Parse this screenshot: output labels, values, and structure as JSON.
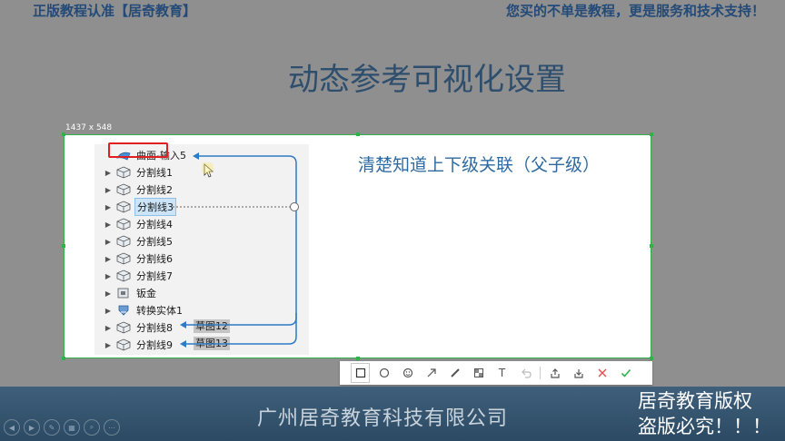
{
  "banner": {
    "left": "正版教程认准【居奇教育】",
    "right": "您买的不单是教程，更是服务和技术支持！"
  },
  "slide": {
    "title": "动态参考可视化设置",
    "annotation": "清楚知道上下级关联（父子级）"
  },
  "capture": {
    "dimensions": "1437 x 548"
  },
  "tree": {
    "items": [
      {
        "label": "曲面-输入5",
        "icon": "surface-icon",
        "selected": false
      },
      {
        "label": "分割线1",
        "icon": "part-icon",
        "selected": false
      },
      {
        "label": "分割线2",
        "icon": "part-icon",
        "selected": false
      },
      {
        "label": "分割线3",
        "icon": "part-icon",
        "selected": true
      },
      {
        "label": "分割线4",
        "icon": "part-icon",
        "selected": false
      },
      {
        "label": "分割线5",
        "icon": "part-icon",
        "selected": false
      },
      {
        "label": "分割线6",
        "icon": "part-icon",
        "selected": false
      },
      {
        "label": "分割线7",
        "icon": "part-icon",
        "selected": false
      },
      {
        "label": "钣金",
        "icon": "sheet-metal-icon",
        "selected": false
      },
      {
        "label": "转换实体1",
        "icon": "convert-entity-icon",
        "selected": false
      },
      {
        "label": "分割线8",
        "icon": "part-icon",
        "selected": false
      },
      {
        "label": "分割线9",
        "icon": "part-icon",
        "selected": false
      }
    ],
    "sketch_tags": [
      "草图12",
      "草图13"
    ]
  },
  "toolbar": {
    "tools": [
      "rectangle-icon",
      "ellipse-icon",
      "emoji-icon",
      "arrow-icon",
      "pen-icon",
      "mosaic-icon",
      "text-icon",
      "undo-icon",
      "share-icon",
      "download-icon",
      "close-icon",
      "confirm-icon"
    ],
    "text_tool": "T"
  },
  "palette": {
    "colors": [
      "#ff0000",
      "#ffa500",
      "#1e90ff",
      "#2ea44f",
      "#444444",
      "#ffffff"
    ],
    "selected_color": "#ff0000"
  },
  "footer": {
    "company": "广州居奇教育科技有限公司",
    "copyright_line1": "居奇教育版权",
    "copyright_line2": "盗版必究！！！"
  },
  "colors": {
    "accent_green": "#2fb24a",
    "link_blue": "#2e7bc4",
    "highlight_red": "#e02020"
  }
}
